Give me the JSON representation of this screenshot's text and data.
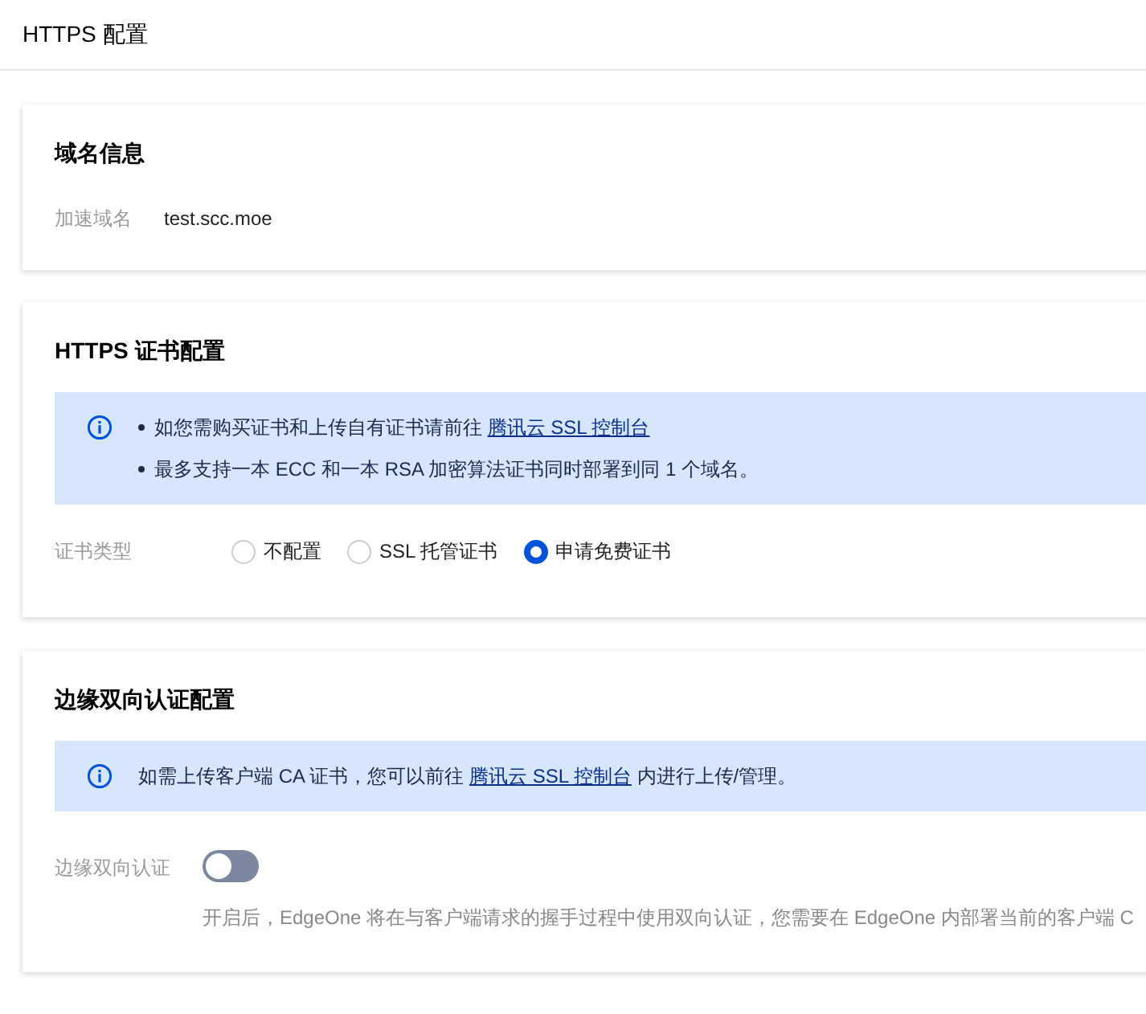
{
  "page_title": "HTTPS 配置",
  "domain_card": {
    "title": "域名信息",
    "label": "加速域名",
    "value": "test.scc.moe"
  },
  "cert_card": {
    "title": "HTTPS 证书配置",
    "notice": {
      "kind": "bulleted",
      "items": [
        {
          "text": "如您需购买证书和上传自有证书请前往",
          "link": "腾讯云 SSL 控制台"
        },
        {
          "text": "最多支持一本 ECC 和一本 RSA 加密算法证书同时部署到同 1 个域名。"
        }
      ]
    },
    "label": "证书类型",
    "options": [
      {
        "label": "不配置",
        "selected": false
      },
      {
        "label": "SSL 托管证书",
        "selected": false
      },
      {
        "label": "申请免费证书",
        "selected": true
      }
    ]
  },
  "mtls_card": {
    "title": "边缘双向认证配置",
    "notice": {
      "kind": "plain",
      "items": [
        {
          "text": "如需上传客户端 CA 证书，您可以前往",
          "link": "腾讯云 SSL 控制台",
          "after": "内进行上传/管理。"
        }
      ]
    },
    "label": "边缘双向认证",
    "on": false,
    "description": "开启后，EdgeOne 将在与客户端请求的握手过程中使用双向认证，您需要在 EdgeOne 内部署当前的客户端 C"
  }
}
